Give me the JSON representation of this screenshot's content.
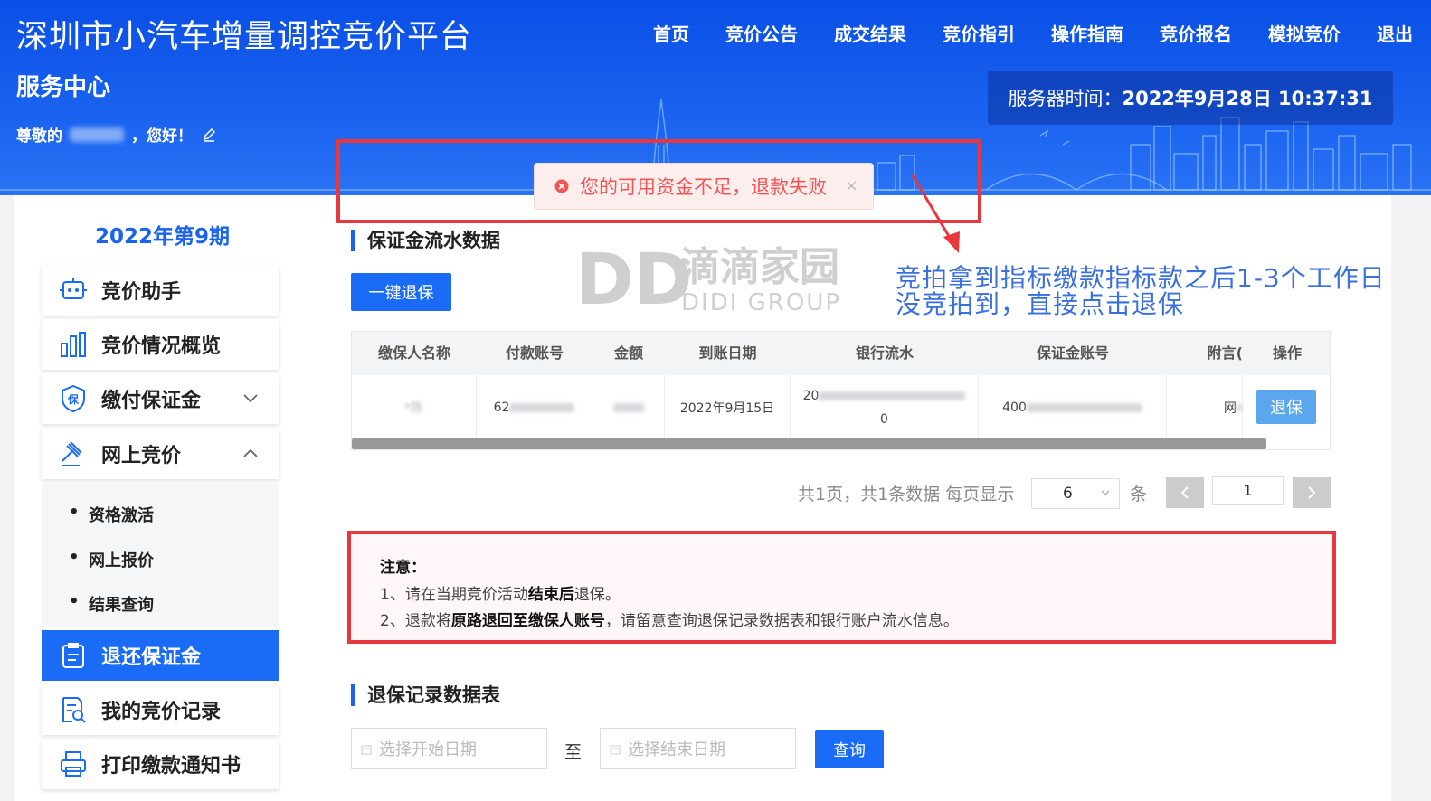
{
  "header": {
    "site_title": "深圳市小汽车增量调控竞价平台",
    "service_center": "服务中心",
    "greeting_prefix": "尊敬的",
    "greeting_suffix": "，您好！",
    "server_time_label": "服务器时间：",
    "server_time_value": "2022年9月28日 10:37:31",
    "nav": [
      "首页",
      "竞价公告",
      "成交结果",
      "竞价指引",
      "操作指南",
      "竞价报名",
      "模拟竞价",
      "退出"
    ]
  },
  "toast": {
    "message": "您的可用资金不足，退款失败",
    "close": "×"
  },
  "sidebar": {
    "period": "2022年第9期",
    "items": [
      {
        "label": "竞价助手"
      },
      {
        "label": "竞价情况概览"
      },
      {
        "label": "缴付保证金"
      },
      {
        "label": "网上竞价"
      },
      {
        "label": "退还保证金"
      },
      {
        "label": "我的竞价记录"
      },
      {
        "label": "打印缴款通知书"
      }
    ],
    "subitems": [
      "资格激活",
      "网上报价",
      "结果查询"
    ]
  },
  "deposit": {
    "title": "保证金流水数据",
    "refund_all_button": "一键退保",
    "columns": [
      "缴保人名称",
      "付款账号",
      "金额",
      "到账日期",
      "银行流水",
      "保证金账号",
      "附言(",
      "操作"
    ],
    "row": {
      "payer_visible": "*陈",
      "account_prefix": "62",
      "date": "2022年9月15日",
      "bank_flow_prefix": "20",
      "bank_flow_suffix": "0",
      "deposit_account_prefix": "400",
      "note_prefix": "网",
      "action": "退保"
    }
  },
  "pagination": {
    "info": "共1页，共1条数据 每页显示",
    "page_size": "6",
    "unit": "条",
    "current_page": "1"
  },
  "notice": {
    "title": "注意：",
    "line1_a": "1、请在当期竞价活动",
    "line1_b": "结束后",
    "line1_c": "退保。",
    "line2_a": "2、退款将",
    "line2_b": "原路退回至缴保人账号",
    "line2_c": "，请留意查询退保记录数据表和银行账户流水信息。"
  },
  "watermark": {
    "mark": "DD",
    "cn": "滴滴家园",
    "en": "DIDI GROUP"
  },
  "annotation": {
    "line1": "竞拍拿到指标缴款指标款之后1-3个工作日",
    "line2": "没竞拍到，直接点击退保"
  },
  "records": {
    "title": "退保记录数据表",
    "start_placeholder": "选择开始日期",
    "separator": "至",
    "end_placeholder": "选择结束日期",
    "query_button": "查询"
  },
  "colors": {
    "primary": "#1a6bf5",
    "alert": "#e8383d",
    "annotation": "#3a6fe0"
  }
}
